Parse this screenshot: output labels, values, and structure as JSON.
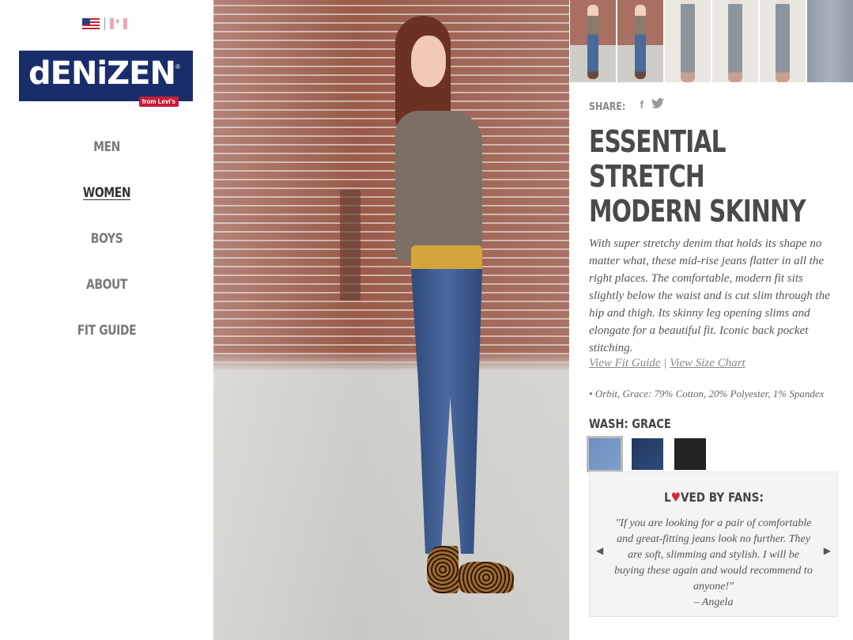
{
  "brand": {
    "logo_text": "dENiZEN",
    "logo_sub": "from Levi's"
  },
  "flags": [
    {
      "name": "us-flag-icon"
    },
    {
      "name": "canada-flag-icon"
    }
  ],
  "nav": {
    "items": [
      {
        "label": "MEN",
        "active": false
      },
      {
        "label": "WOMEN",
        "active": true
      },
      {
        "label": "BOYS",
        "active": false
      },
      {
        "label": "ABOUT",
        "active": false
      },
      {
        "label": "FIT GUIDE",
        "active": false
      }
    ]
  },
  "product": {
    "share_label": "SHARE:",
    "share_icons": [
      "facebook-icon",
      "twitter-icon"
    ],
    "title_line1": "ESSENTIAL STRETCH",
    "title_line2": "MODERN SKINNY",
    "description": "With super stretchy denim that holds its shape no matter what, these mid-rise jeans flatter in all the right places. The comfortable, modern fit sits slightly below the waist and is cut slim through the hip and thigh. Its skinny leg opening slims and elongate for a beautiful fit. Iconic back pocket stitching.",
    "link_fit_guide": "View Fit Guide",
    "link_separator": "|",
    "link_size_chart": "View Size Chart",
    "fabric": "• Orbit, Grace: 79% Cotton, 20% Polyester, 1% Spandex",
    "wash_label": "WASH: GRACE",
    "swatch_colors": [
      "#7193c2",
      "#28406a",
      "#232326"
    ]
  },
  "fans": {
    "title_prefix": "L",
    "title_heart": "♥",
    "title_suffix": "VED BY FANS:",
    "quote": "\"If you are looking for a pair of comfortable and great-fitting jeans look no further. They are soft, slimming and stylish. I will be buying these again and would recommend to anyone!\"",
    "author": "– Angela",
    "prev_arrow": "◀",
    "next_arrow": "▶"
  }
}
